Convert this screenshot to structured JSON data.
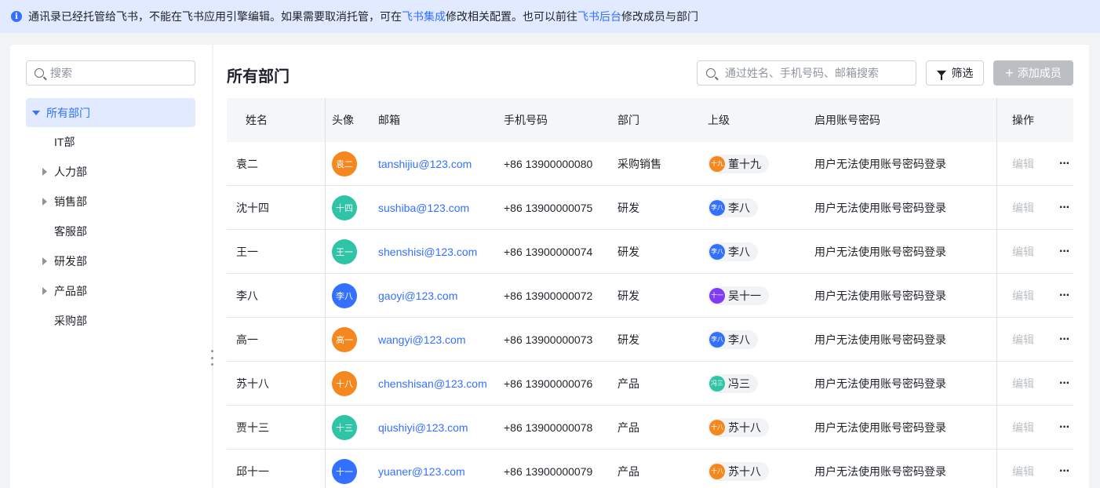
{
  "banner": {
    "text_before": "通讯录已经托管给飞书，不能在飞书应用引擎编辑。如果需要取消托管，可在",
    "link1": "飞书集成",
    "text_middle": "修改相关配置。也可以前往",
    "link2": "飞书后台",
    "text_after": "修改成员与部门"
  },
  "sidebar": {
    "search_placeholder": "搜索",
    "tree": [
      {
        "label": "所有部门",
        "active": true,
        "expand": "down"
      },
      {
        "label": "IT部",
        "expand": "none"
      },
      {
        "label": "人力部",
        "expand": "right"
      },
      {
        "label": "销售部",
        "expand": "right"
      },
      {
        "label": "客服部",
        "expand": "none"
      },
      {
        "label": "研发部",
        "expand": "right"
      },
      {
        "label": "产品部",
        "expand": "right"
      },
      {
        "label": "采购部",
        "expand": "none"
      }
    ]
  },
  "main": {
    "title": "所有部门",
    "search_placeholder": "通过姓名、手机号码、邮箱搜索",
    "filter_label": "筛选",
    "add_label": "添加成员"
  },
  "table": {
    "headers": {
      "name": "姓名",
      "avatar": "头像",
      "email": "邮箱",
      "phone": "手机号码",
      "dept": "部门",
      "superior": "上级",
      "login": "启用账号密码",
      "op": "操作"
    },
    "edit_label": "编辑",
    "more_label": "···",
    "rows": [
      {
        "name": "袁二",
        "avatar_text": "袁二",
        "avatar_color": "#f5871f",
        "email": "tanshijiu@123.com",
        "phone": "+86 13900000080",
        "dept": "采购销售",
        "sup_name": "董十九",
        "sup_mini": "十九",
        "sup_color": "#f5871f",
        "login": "用户无法使用账号密码登录"
      },
      {
        "name": "沈十四",
        "avatar_text": "十四",
        "avatar_color": "#2fc4a6",
        "email": "sushiba@123.com",
        "phone": "+86 13900000075",
        "dept": "研发",
        "sup_name": "李八",
        "sup_mini": "李八",
        "sup_color": "#3370ff",
        "login": "用户无法使用账号密码登录"
      },
      {
        "name": "王一",
        "avatar_text": "王一",
        "avatar_color": "#2fc4a6",
        "email": "shenshisi@123.com",
        "phone": "+86 13900000074",
        "dept": "研发",
        "sup_name": "李八",
        "sup_mini": "李八",
        "sup_color": "#3370ff",
        "login": "用户无法使用账号密码登录"
      },
      {
        "name": "李八",
        "avatar_text": "李八",
        "avatar_color": "#3370ff",
        "email": "gaoyi@123.com",
        "phone": "+86 13900000072",
        "dept": "研发",
        "sup_name": "吴十一",
        "sup_mini": "十一",
        "sup_color": "#7f3bf5",
        "login": "用户无法使用账号密码登录"
      },
      {
        "name": "高一",
        "avatar_text": "高一",
        "avatar_color": "#f5871f",
        "email": "wangyi@123.com",
        "phone": "+86 13900000073",
        "dept": "研发",
        "sup_name": "李八",
        "sup_mini": "李八",
        "sup_color": "#3370ff",
        "login": "用户无法使用账号密码登录"
      },
      {
        "name": "苏十八",
        "avatar_text": "十八",
        "avatar_color": "#f5871f",
        "email": "chenshisan@123.com",
        "phone": "+86 13900000076",
        "dept": "产品",
        "sup_name": "冯三",
        "sup_mini": "冯三",
        "sup_color": "#2fc4a6",
        "login": "用户无法使用账号密码登录"
      },
      {
        "name": "贾十三",
        "avatar_text": "十三",
        "avatar_color": "#2fc4a6",
        "email": "qiushiyi@123.com",
        "phone": "+86 13900000078",
        "dept": "产品",
        "sup_name": "苏十八",
        "sup_mini": "十八",
        "sup_color": "#f5871f",
        "login": "用户无法使用账号密码登录"
      },
      {
        "name": "邱十一",
        "avatar_text": "十一",
        "avatar_color": "#3370ff",
        "email": "yuaner@123.com",
        "phone": "+86 13900000079",
        "dept": "产品",
        "sup_name": "苏十八",
        "sup_mini": "十八",
        "sup_color": "#f5871f",
        "login": "用户无法使用账号密码登录"
      }
    ]
  }
}
